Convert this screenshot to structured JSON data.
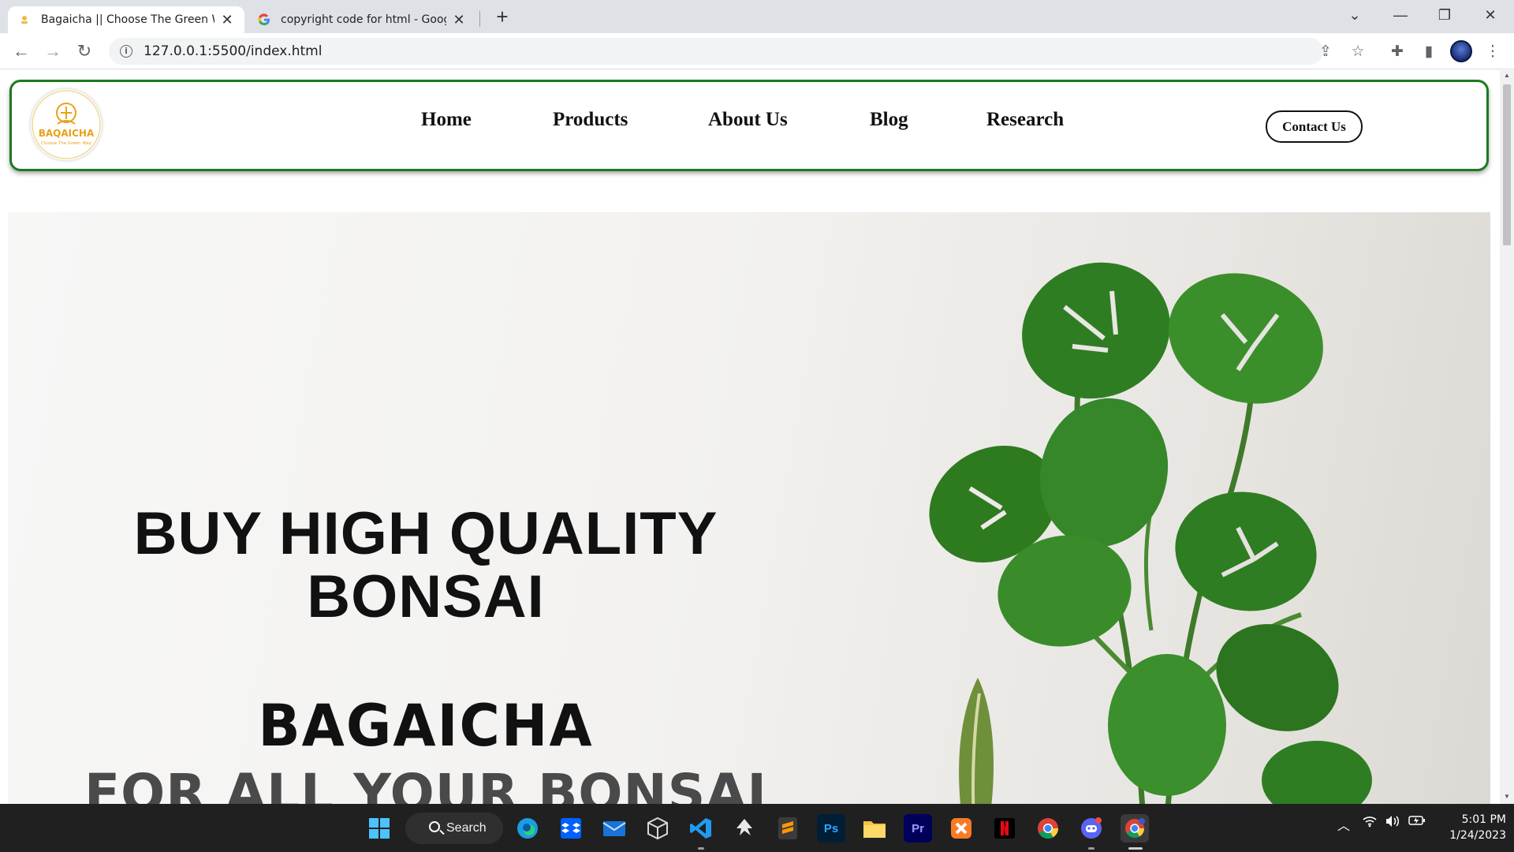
{
  "browser": {
    "tabs": [
      {
        "title": "Bagaicha || Choose The Green W",
        "active": true
      },
      {
        "title": "copyright code for html - Google",
        "active": false
      }
    ],
    "url": "127.0.0.1:5500/index.html"
  },
  "site": {
    "logo": {
      "name": "BAQAICHA",
      "tagline": "Choose The Green Way"
    },
    "nav": [
      "Home",
      "Products",
      "About Us",
      "Blog",
      "Research"
    ],
    "contact_label": "Contact Us",
    "hero": {
      "title_line1": "BUY HIGH QUALITY",
      "title_line2": "BONSAI",
      "brand": "BAGAICHA",
      "tagline": "FOR ALL YOUR BONSAI"
    }
  },
  "taskbar": {
    "search_label": "Search",
    "time": "5:01 PM",
    "date": "1/24/2023",
    "apps": [
      "windows-start",
      "edge",
      "dropbox",
      "mail",
      "virtualbox",
      "vscode",
      "inkscape",
      "sublime-text",
      "photoshop",
      "file-explorer",
      "premiere-pro",
      "xampp",
      "netflix",
      "chrome",
      "discord",
      "chrome-profile"
    ]
  },
  "colors": {
    "header_border": "#1d7a1d",
    "logo_gold": "#e8a21a",
    "taskbar": "#202020"
  }
}
